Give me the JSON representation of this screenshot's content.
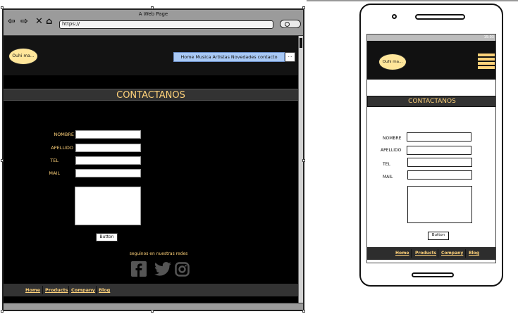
{
  "browser": {
    "title": "A Web Page",
    "url": "https://",
    "nav_icons": [
      "back-arrow-icon",
      "forward-arrow-icon",
      "close-icon",
      "home-icon"
    ]
  },
  "site": {
    "logo": "Ouhi ma...",
    "menu": "Home Musica Artistas Novedades contacto",
    "menu_more": "...",
    "title": "CONTACTANOS",
    "form": {
      "labels": [
        "NOMBRE",
        "APELLIDO",
        "TEL",
        "MAIL"
      ],
      "button": "Button"
    },
    "social_text": "seguinos en nuestras redes",
    "social_icons": [
      "facebook-icon",
      "twitter-icon",
      "instagram-icon"
    ],
    "footer": [
      "Home",
      "Products",
      "Company",
      "Blog"
    ]
  },
  "mobile": {
    "status_time": "15:03",
    "logo": "Ouhi ma...",
    "title": "CONTACTANOS",
    "labels": [
      "NOMBRE",
      "APELLIDO",
      "TEL",
      "MAIL"
    ],
    "button": "Button",
    "footer": [
      "Home",
      "Products",
      "Company",
      "Blog"
    ]
  },
  "colors": {
    "accent": "#ffd27a",
    "page_bg": "#000000",
    "band": "#333333",
    "menu_bg": "#a9c9f5",
    "logo_bg": "#ffe69a"
  }
}
